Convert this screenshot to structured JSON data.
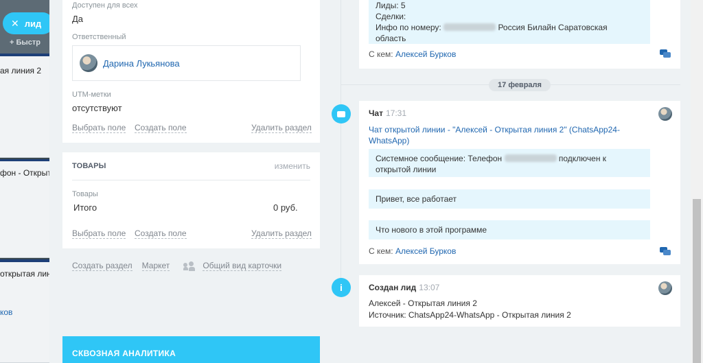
{
  "background": {
    "lid_pill": {
      "close": "✕",
      "label": "лид"
    },
    "quick": "Быстр",
    "band1_text": "ая линия 2",
    "band2_text": "фон - Открыт",
    "band3_text": "открытая лини",
    "band3_link": "ков"
  },
  "fields": {
    "available_label": "Доступен для всех",
    "available_value": "Да",
    "responsible_label": "Ответственный",
    "responsible_name": "Дарина Лукьянова",
    "utm_label": "UTM-метки",
    "utm_value": "отсутствуют",
    "select_field": "Выбрать поле",
    "create_field": "Создать поле",
    "delete_section": "Удалить раздел"
  },
  "products": {
    "title": "ТОВАРЫ",
    "change": "изменить",
    "label": "Товары",
    "total_label": "Итого",
    "total_value": "0 руб.",
    "select_field": "Выбрать поле",
    "create_field": "Создать поле",
    "delete_section": "Удалить раздел"
  },
  "below_links": {
    "create_section": "Создать раздел",
    "market": "Маркет",
    "card_view": "Общий вид карточки"
  },
  "analytics": {
    "title": "СКВОЗНАЯ АНАЛИТИКА"
  },
  "timeline": {
    "top_bubble": {
      "line1": "Лиды: 5",
      "line2": "Сделки:",
      "line3_prefix": "Инфо по номеру:",
      "line3_suffix": "Россия Билайн Саратовская",
      "line4": "область"
    },
    "top_with_label": "С кем:",
    "top_with_name": "Алексей Бурков",
    "date": "17 февраля",
    "chat": {
      "title": "Чат",
      "time": "17:31",
      "link_line1": "Чат открытой линии - \"Алексей - Открытая линия 2\" (ChatsApp24-",
      "link_line2": "WhatsApp)",
      "msg1_prefix": "Системное сообщение: Телефон",
      "msg1_suffix": "подключен к",
      "msg1_line2": "открытой линии",
      "msg2": "Привет, все работает",
      "msg3": "Что нового в этой программе",
      "with_label": "С кем:",
      "with_name": "Алексей Бурков"
    },
    "created": {
      "title": "Создан лид",
      "time": "13:07",
      "line1": "Алексей - Открытая линия 2",
      "line2": "Источник: ChatsApp24-WhatsApp - Открытая линия 2"
    }
  },
  "icons": {
    "chat_icon": "chat-bubble-icon",
    "info_icon": "info-icon",
    "info_glyph": "i"
  },
  "colors": {
    "accent": "#2fc6f6",
    "link": "#2067b0",
    "bubble": "#e5f6fd"
  }
}
